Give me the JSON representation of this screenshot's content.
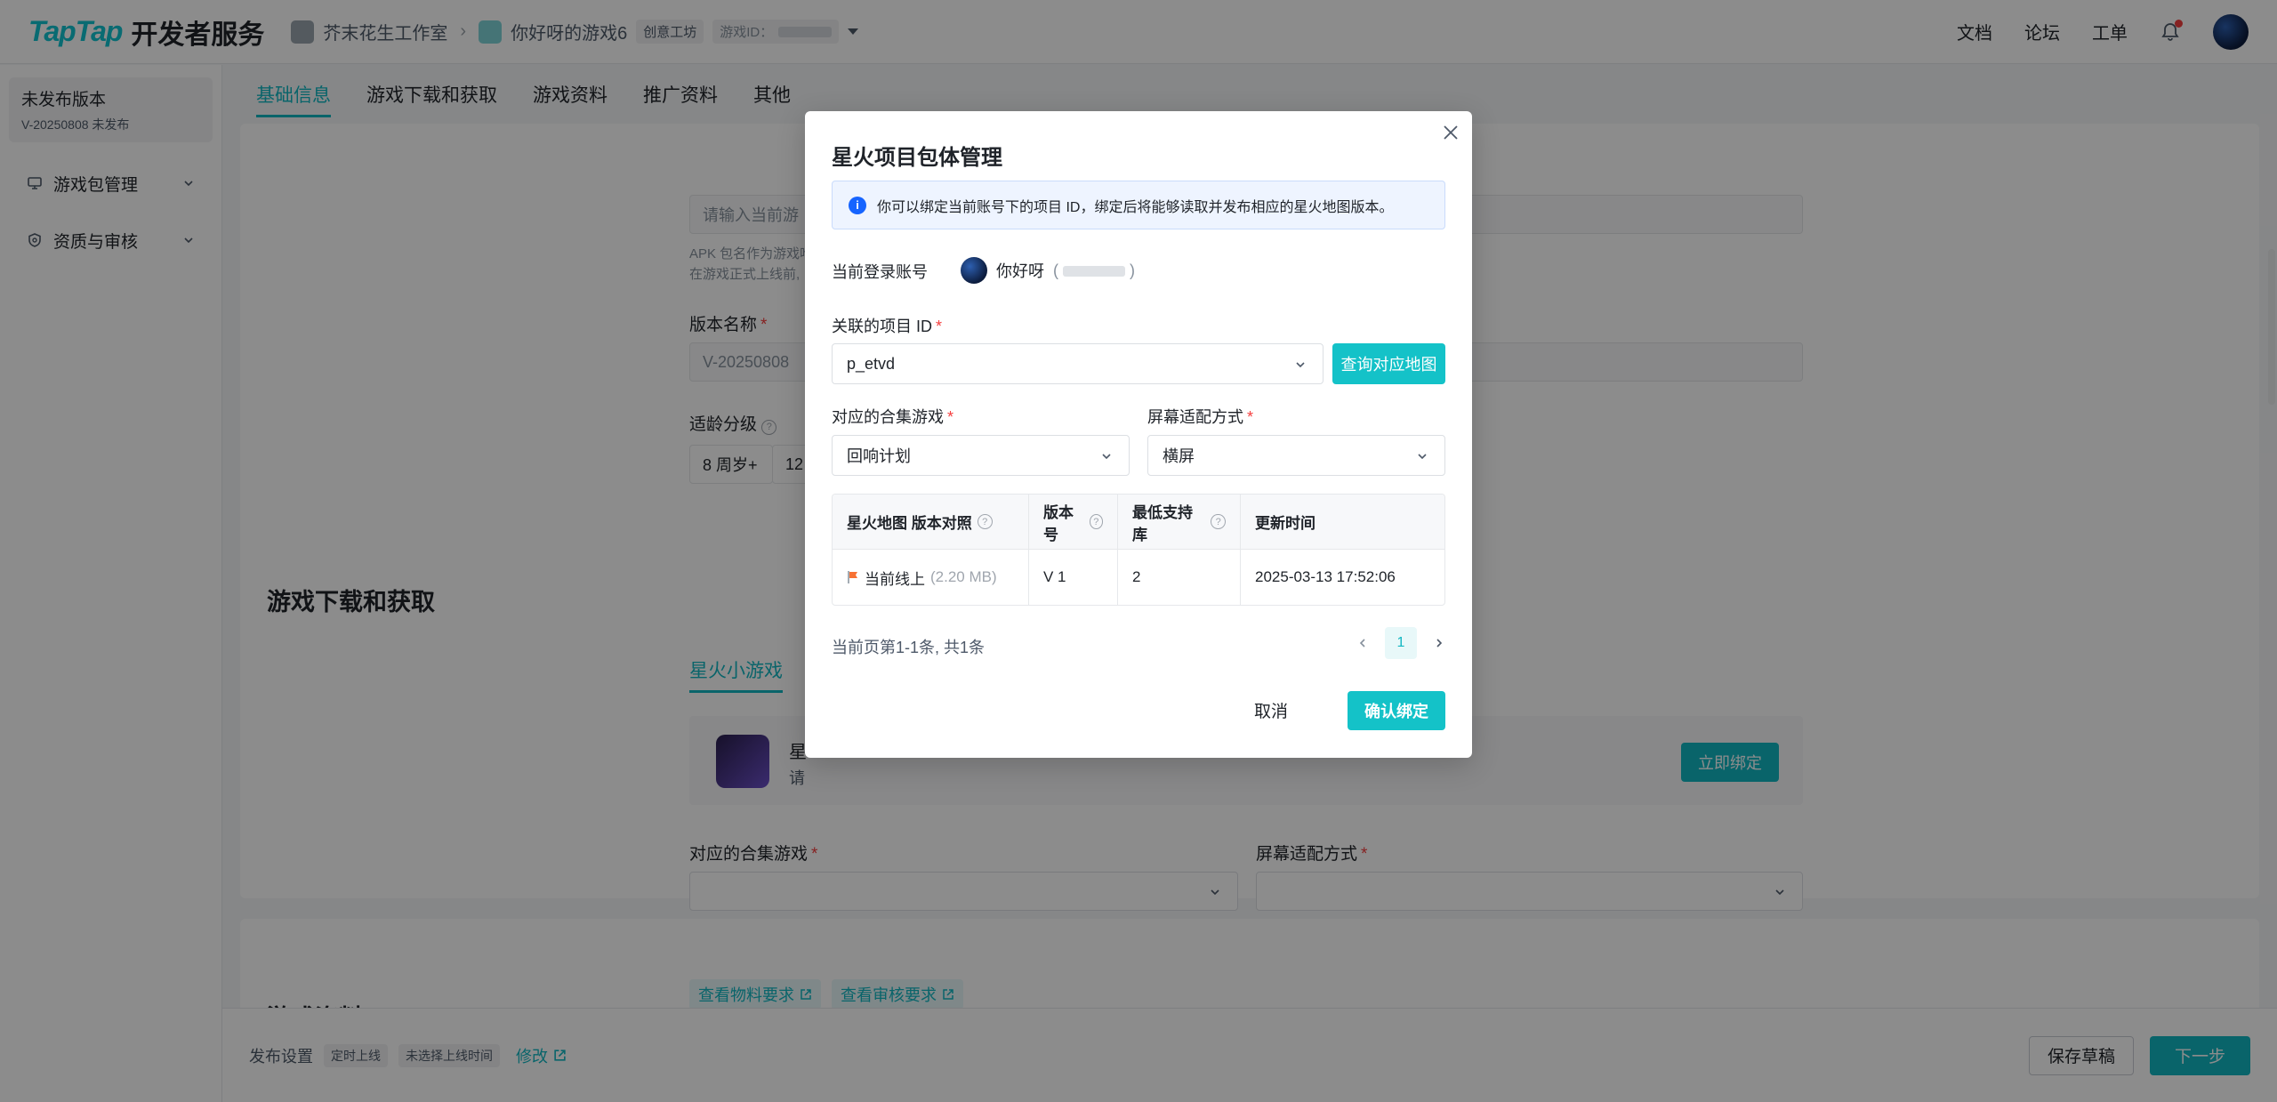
{
  "header": {
    "brand": "TapTap",
    "brand_cn": "开发者服务",
    "studio": "芥末花生工作室",
    "game": "你好呀的游戏6",
    "game_tag": "创意工坊",
    "game_id_label": "游戏ID：",
    "nav": [
      "文档",
      "论坛",
      "工单"
    ]
  },
  "sidebar": {
    "version_title": "未发布版本",
    "version_sub": "V-20250808 未发布",
    "items": [
      {
        "label": "游戏包管理",
        "icon": "monitor-icon"
      },
      {
        "label": "资质与审核",
        "icon": "shield-icon"
      }
    ]
  },
  "main": {
    "tabs": [
      "基础信息",
      "游戏下载和获取",
      "游戏资料",
      "推广资料",
      "其他"
    ],
    "package_input_placeholder": "请输入当前游",
    "apk_hint_1": "APK 包名作为游戏唯",
    "apk_hint_2": "在游戏正式上线前,",
    "version_name_label": "版本名称",
    "version_name_value": "V-20250808",
    "age_label": "适龄分级",
    "age_options": [
      "8 周岁+",
      "12"
    ],
    "download_title": "游戏下载和获取",
    "download_subtab": "星火小游戏",
    "star_title": "星",
    "star_desc": "请",
    "bind_now": "立即绑定",
    "collection_label": "对应的合集游戏",
    "screen_label": "屏幕适配方式",
    "material_title": "游戏资料",
    "material_links": [
      "查看物料要求",
      "查看审核要求"
    ]
  },
  "bottom": {
    "publish_label": "发布设置",
    "tag_timing": "定时上线",
    "tag_unselected": "未选择上线时间",
    "modify": "修改",
    "save_draft": "保存草稿",
    "next": "下一步"
  },
  "modal": {
    "title": "星火项目包体管理",
    "info": "你可以绑定当前账号下的项目 ID，绑定后将能够读取并发布相应的星火地图版本。",
    "account_label": "当前登录账号",
    "account_name": "你好呀",
    "project_label": "关联的项目 ID",
    "project_value": "p_etvd",
    "query_btn": "查询对应地图",
    "collection_label": "对应的合集游戏",
    "collection_value": "回响计划",
    "screen_label": "屏幕适配方式",
    "screen_value": "横屏",
    "table": {
      "headers": [
        "星火地图 版本对照",
        "版本号",
        "最低支持库",
        "更新时间"
      ],
      "rows": [
        {
          "status": "当前线上",
          "size": "(2.20 MB)",
          "version": "V 1",
          "min_lib": "2",
          "updated": "2025-03-13 17:52:06"
        }
      ]
    },
    "pager_info": "当前页第1-1条, 共1条",
    "page": "1",
    "cancel": "取消",
    "confirm": "确认绑定"
  },
  "colors": {
    "accent": "#12b7c2",
    "required": "#f53f3f",
    "info": "#1664ff"
  }
}
